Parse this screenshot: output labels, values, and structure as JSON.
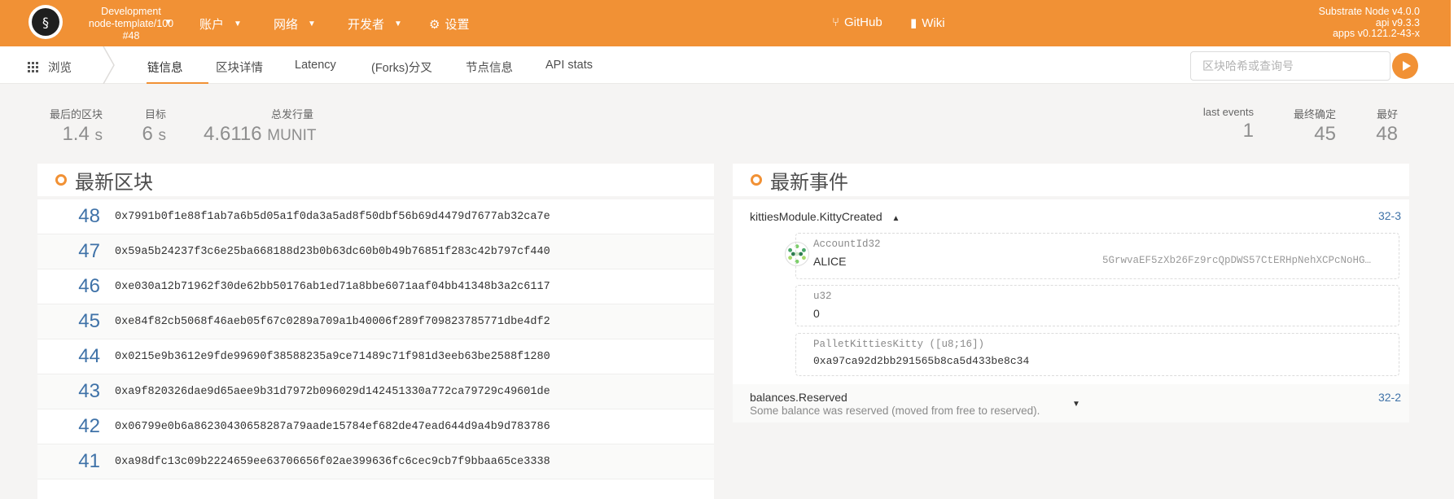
{
  "topbar": {
    "chain_name": "Development",
    "chain_node": "node-template/100",
    "chain_block": "#48",
    "nav": [
      {
        "label": "账户"
      },
      {
        "label": "网络"
      },
      {
        "label": "开发者"
      },
      {
        "label": "设置"
      }
    ],
    "links": [
      {
        "label": "GitHub"
      },
      {
        "label": "Wiki"
      }
    ],
    "version_node": "Substrate Node v4.0.0",
    "version_api": "api v9.3.3",
    "version_apps": "apps v0.121.2-43-x"
  },
  "subnav": {
    "browse_label": "浏览",
    "tabs": [
      {
        "label": "链信息"
      },
      {
        "label": "区块详情"
      },
      {
        "label": "Latency"
      },
      {
        "label": "(Forks)分叉"
      },
      {
        "label": "节点信息"
      },
      {
        "label": "API stats"
      }
    ],
    "search_placeholder": "区块哈希或查询号"
  },
  "summary": {
    "last_block_label": "最后的区块",
    "last_block_value": "1.4",
    "last_block_unit": "s",
    "target_label": "目标",
    "target_value": "6",
    "target_unit": "s",
    "issuance_label": "总发行量",
    "issuance_value": "4.6116",
    "issuance_unit": "MUNIT",
    "last_events_label": "last events",
    "last_events_value": "1",
    "finalized_label": "最终确定",
    "finalized_value": "45",
    "best_label": "最好",
    "best_value": "48"
  },
  "recent_blocks": {
    "title": "最新区块",
    "rows": [
      {
        "number": "48",
        "hash": "0x7991b0f1e88f1ab7a6b5d05a1f0da3a5ad8f50dbf56b69d4479d7677ab32ca7e"
      },
      {
        "number": "47",
        "hash": "0x59a5b24237f3c6e25ba668188d23b0b63dc60b0b49b76851f283c42b797cf440"
      },
      {
        "number": "46",
        "hash": "0xe030a12b71962f30de62bb50176ab1ed71a8bbe6071aaf04bb41348b3a2c6117"
      },
      {
        "number": "45",
        "hash": "0xe84f82cb5068f46aeb05f67c0289a709a1b40006f289f709823785771dbe4df2"
      },
      {
        "number": "44",
        "hash": "0x0215e9b3612e9fde99690f38588235a9ce71489c71f981d3eeb63be2588f1280"
      },
      {
        "number": "43",
        "hash": "0xa9f820326dae9d65aee9b31d7972b096029d142451330a772ca79729c49601de"
      },
      {
        "number": "42",
        "hash": "0x06799e0b6a86230430658287a79aade15784ef682de47ead644d9a4b9d783786"
      },
      {
        "number": "41",
        "hash": "0xa98dfc13c09b2224659ee63706656f02ae399636fc6cec9cb7f9bbaa65ce3338"
      }
    ]
  },
  "recent_events": {
    "title": "最新事件",
    "event1": {
      "name": "kittiesModule.KittyCreated",
      "ref": "32-3",
      "params": [
        {
          "type": "AccountId32",
          "value": "ALICE",
          "address": "5GrwvaEF5zXb26Fz9rcQpDWS57CtERHpNehXCPcNoHG…"
        },
        {
          "type": "u32",
          "value": "0"
        },
        {
          "type": "PalletKittiesKitty ([u8;16])",
          "value": "0xa97ca92d2bb291565b8ca5d433be8c34"
        }
      ]
    },
    "event2": {
      "name": "balances.Reserved",
      "desc": "Some balance was reserved (moved from free to reserved).",
      "ref": "32-2"
    }
  },
  "colors": {
    "accent": "#f19135",
    "link": "#3f72a8"
  }
}
